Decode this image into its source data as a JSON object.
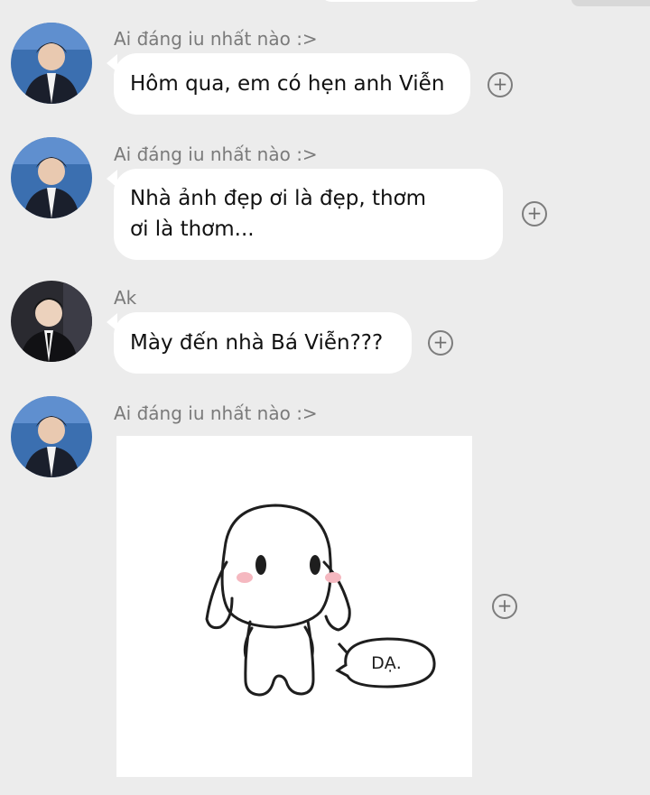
{
  "messages": [
    {
      "sender": "Ai đáng iu nhất nào :>",
      "text": "Hôm qua, em có hẹn anh Viễn",
      "avatar": "avatar-guy-1"
    },
    {
      "sender": "Ai đáng iu nhất nào :>",
      "lines": [
        "Nhà ảnh đẹp ơi là đẹp, thơm",
        "ơi là thơm..."
      ],
      "avatar": "avatar-guy-1"
    },
    {
      "sender": "Ak",
      "text": "Mày đến nhà Bá Viễn???",
      "avatar": "avatar-guy-2"
    },
    {
      "sender": "Ai đáng iu nhất nào :>",
      "sticker_text": "DẠ.",
      "avatar": "avatar-guy-1"
    }
  ],
  "icons": {
    "add": "plus-circle-icon"
  },
  "colors": {
    "background": "#ececec",
    "bubble": "#ffffff",
    "sender_text": "#7a7a7a",
    "icon": "#7d7d7d"
  }
}
